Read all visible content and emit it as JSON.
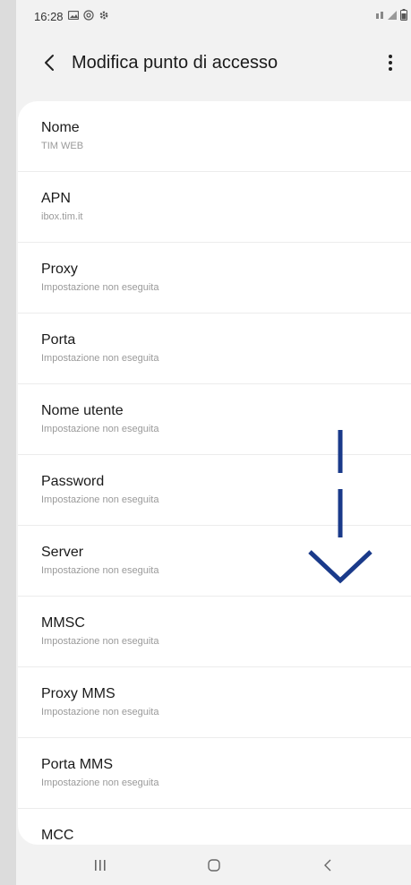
{
  "status_bar": {
    "time": "16:28",
    "left_icons": [
      "image-icon",
      "at-icon",
      "gear-icon"
    ],
    "right_icons": [
      "wifi-calling-icon",
      "signal-icon",
      "battery-icon"
    ]
  },
  "header": {
    "title": "Modifica punto di accesso"
  },
  "settings": [
    {
      "label": "Nome",
      "value": "TIM WEB"
    },
    {
      "label": "APN",
      "value": "ibox.tim.it"
    },
    {
      "label": "Proxy",
      "value": "Impostazione non eseguita"
    },
    {
      "label": "Porta",
      "value": "Impostazione non eseguita"
    },
    {
      "label": "Nome utente",
      "value": "Impostazione non eseguita"
    },
    {
      "label": "Password",
      "value": "Impostazione non eseguita"
    },
    {
      "label": "Server",
      "value": "Impostazione non eseguita"
    },
    {
      "label": "MMSC",
      "value": "Impostazione non eseguita"
    },
    {
      "label": "Proxy MMS",
      "value": "Impostazione non eseguita"
    },
    {
      "label": "Porta MMS",
      "value": "Impostazione non eseguita"
    },
    {
      "label": "MCC",
      "value": ""
    }
  ],
  "colors": {
    "arrow": "#1a3a8a",
    "background": "#f2f2f2",
    "card": "#ffffff"
  },
  "nav_bar": [
    "recent-apps-icon",
    "home-icon",
    "back-icon"
  ]
}
